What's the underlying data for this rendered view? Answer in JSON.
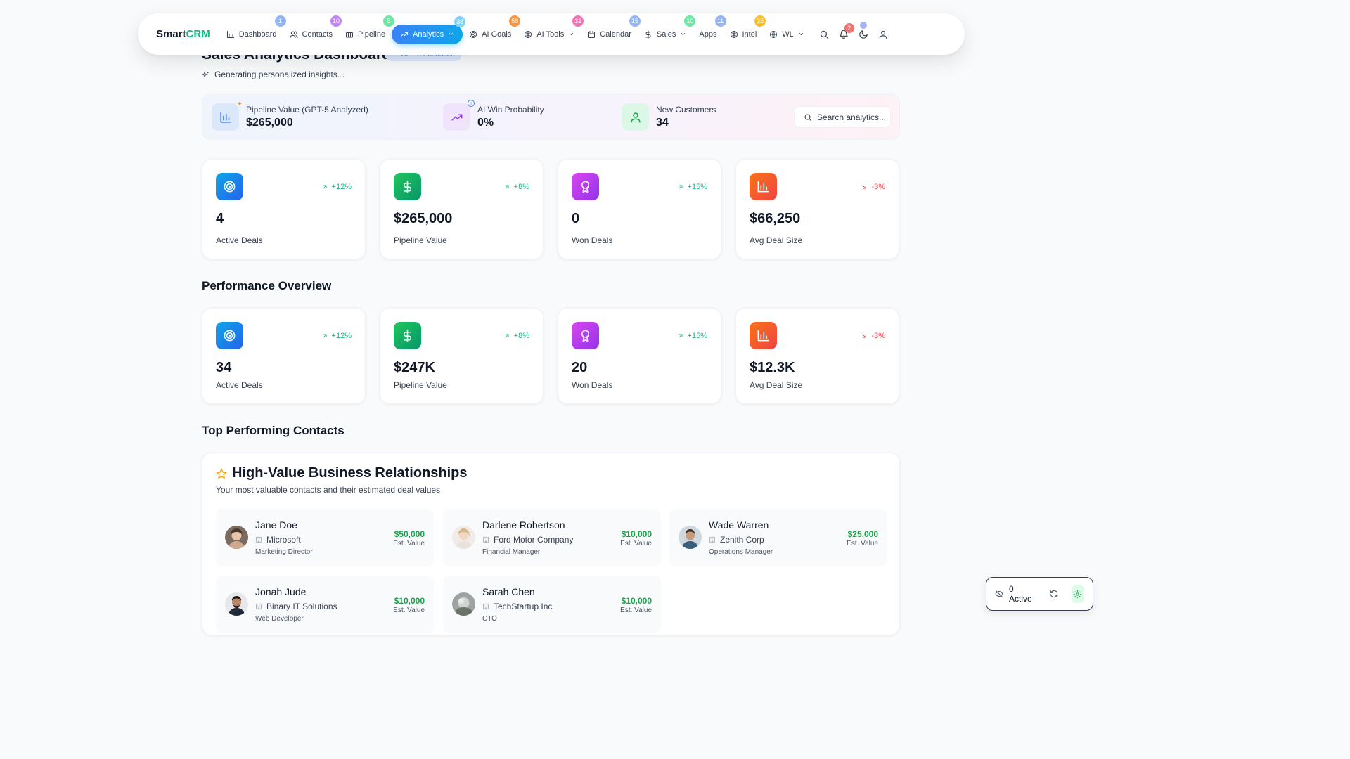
{
  "brand": {
    "prefix": "Smart",
    "accent": "CRM"
  },
  "nav": [
    {
      "label": "Dashboard",
      "badge": "1",
      "icon": "bar-chart-icon"
    },
    {
      "label": "Contacts",
      "badge": "10",
      "icon": "users-icon"
    },
    {
      "label": "Pipeline",
      "badge": "5",
      "icon": "briefcase-icon"
    },
    {
      "label": "Analytics",
      "badge": "38",
      "icon": "trending-up-icon",
      "active": true
    },
    {
      "label": "AI Goals",
      "badge": "58",
      "icon": "target-icon"
    },
    {
      "label": "AI Tools",
      "badge": "32",
      "icon": "brain-icon"
    },
    {
      "label": "Calendar",
      "badge": "15",
      "icon": "calendar-icon"
    },
    {
      "label": "Sales",
      "badge": "10",
      "icon": "dollar-icon"
    },
    {
      "label": "Apps",
      "badge": "11",
      "icon": "apps-icon"
    },
    {
      "label": "Intel",
      "badge": "35",
      "icon": "brain-icon"
    },
    {
      "label": "WL",
      "badge": "",
      "icon": "globe-icon"
    }
  ],
  "notifications": {
    "count": "2"
  },
  "header": {
    "title": "Sales Analytics Dashboard",
    "badge": "GPT-5 Enhanced",
    "subtitle": "Generating personalized insights..."
  },
  "kpis": [
    {
      "label": "Pipeline Value (GPT-5 Analyzed)",
      "value": "$265,000"
    },
    {
      "label": "AI Win Probability",
      "value": "0%"
    },
    {
      "label": "New Customers",
      "value": "34"
    }
  ],
  "search": {
    "placeholder": "Search analytics..."
  },
  "stats_top": [
    {
      "value": "4",
      "label": "Active Deals",
      "trend": "+12%",
      "direction": "up"
    },
    {
      "value": "$265,000",
      "label": "Pipeline Value",
      "trend": "+8%",
      "direction": "up"
    },
    {
      "value": "0",
      "label": "Won Deals",
      "trend": "+15%",
      "direction": "up"
    },
    {
      "value": "$66,250",
      "label": "Avg Deal Size",
      "trend": "-3%",
      "direction": "down"
    }
  ],
  "performance": {
    "title": "Performance Overview",
    "stats": [
      {
        "value": "34",
        "label": "Active Deals",
        "trend": "+12%",
        "direction": "up"
      },
      {
        "value": "$247K",
        "label": "Pipeline Value",
        "trend": "+8%",
        "direction": "up"
      },
      {
        "value": "20",
        "label": "Won Deals",
        "trend": "+15%",
        "direction": "up"
      },
      {
        "value": "$12.3K",
        "label": "Avg Deal Size",
        "trend": "-3%",
        "direction": "down"
      }
    ]
  },
  "top_contacts": {
    "section_title": "Top Performing Contacts",
    "card_title": "High-Value Business Relationships",
    "card_subtitle": "Your most valuable contacts and their estimated deal values",
    "est_label": "Est. Value",
    "contacts": [
      {
        "name": "Jane Doe",
        "company": "Microsoft",
        "role": "Marketing Director",
        "value": "$50,000"
      },
      {
        "name": "Darlene Robertson",
        "company": "Ford Motor Company",
        "role": "Financial Manager",
        "value": "$10,000"
      },
      {
        "name": "Wade Warren",
        "company": "Zenith Corp",
        "role": "Operations Manager",
        "value": "$25,000"
      },
      {
        "name": "Jonah Jude",
        "company": "Binary IT Solutions",
        "role": "Web Developer",
        "value": "$10,000"
      },
      {
        "name": "Sarah Chen",
        "company": "TechStartup Inc",
        "role": "CTO",
        "value": "$10,000"
      }
    ]
  },
  "widget": {
    "label": "0 Active"
  }
}
